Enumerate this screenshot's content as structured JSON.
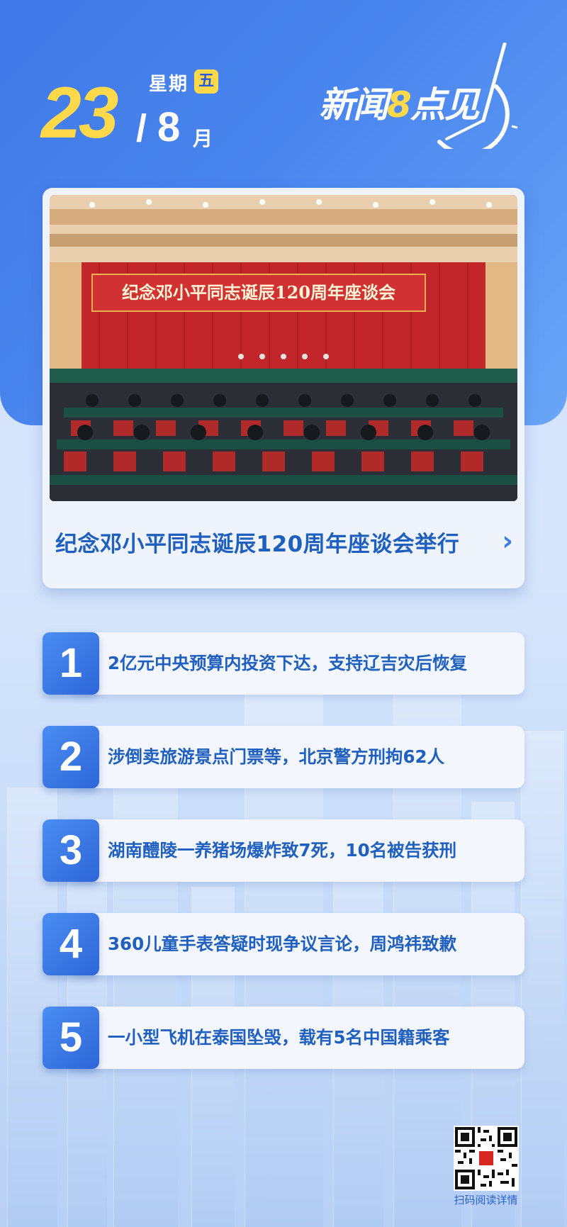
{
  "header": {
    "day": "23",
    "slash": "/",
    "month": "8",
    "month_unit": "月",
    "weekday_prefix": "星期",
    "weekday": "五",
    "logo_part1": "新闻",
    "logo_eight": "8",
    "logo_part2": "点见"
  },
  "hero": {
    "banner_text": "纪念邓小平同志诞辰120周年座谈会",
    "title": "纪念邓小平同志诞辰120周年座谈会举行",
    "arrow": "›"
  },
  "items": [
    {
      "num": "1",
      "text": "2亿元中央预算内投资下达，支持辽吉灾后恢复"
    },
    {
      "num": "2",
      "text": "涉倒卖旅游景点门票等，北京警方刑拘62人"
    },
    {
      "num": "3",
      "text": "湖南醴陵一养猪场爆炸致7死，10名被告获刑"
    },
    {
      "num": "4",
      "text": "360儿童手表答疑时现争议言论，周鸿祎致歉"
    },
    {
      "num": "5",
      "text": "一小型飞机在泰国坠毁，载有5名中国籍乘客"
    }
  ],
  "footer": {
    "qr_label": "扫码阅读详情"
  },
  "colors": {
    "accent_blue": "#2d66d8",
    "accent_yellow": "#ffd94a",
    "banner_red": "#c8282a"
  }
}
